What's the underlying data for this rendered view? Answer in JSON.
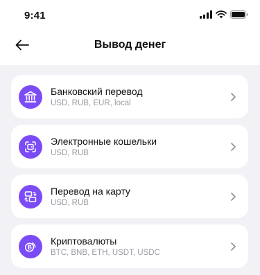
{
  "status_bar": {
    "time": "9:41",
    "icons": [
      "signal-icon",
      "wifi-icon",
      "battery-icon"
    ]
  },
  "header": {
    "title": "Вывод денег",
    "back_icon": "arrow-left-icon"
  },
  "colors": {
    "accent": "#7b4cf6",
    "list_background": "#f2f2f6",
    "subtitle": "#9a9aa3"
  },
  "methods": [
    {
      "title": "Банковский перевод",
      "subtitle": "USD, RUB, EUR, local",
      "icon": "bank-icon"
    },
    {
      "title": "Электронные кошельки",
      "subtitle": "USD, RUB",
      "icon": "e-wallet-icon"
    },
    {
      "title": "Перевод на карту",
      "subtitle": "USD, RUB",
      "icon": "card-transfer-icon"
    },
    {
      "title": "Криптовалюты",
      "subtitle": "BTC, BNB, ETH, USDT, USDC",
      "icon": "crypto-coin-icon"
    }
  ]
}
